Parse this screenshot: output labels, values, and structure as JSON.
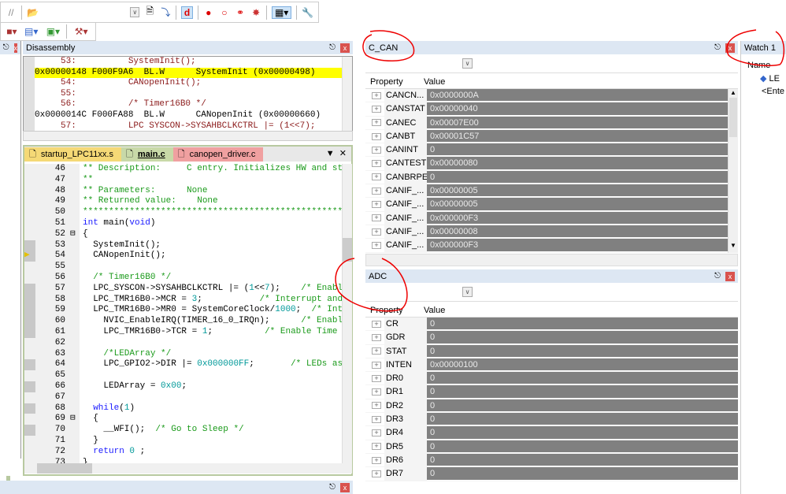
{
  "toolbar": {
    "row1_icons": [
      "comment-icon",
      "open-folder-icon",
      "dropdown-icon",
      "find-icon",
      "download-icon",
      "debug-session-icon",
      "breakpoint-insert-icon",
      "breakpoint-enable-icon",
      "breakpoint-disable-all-icon",
      "breakpoint-kill-all-icon",
      "window-layout-icon",
      "wrench-icon"
    ],
    "row2_icons": [
      "build-icon",
      "batch-icon",
      "chip-icon",
      "tools-icon"
    ]
  },
  "disassembly": {
    "title": "Disassembly",
    "lines": [
      {
        "text": "     53:          SystemInit();",
        "type": "src"
      },
      {
        "text": "0x00000148 F000F9A6  BL.W      SystemInit (0x00000498)",
        "type": "current"
      },
      {
        "text": "     54:          CANopenInit();",
        "type": "src"
      },
      {
        "text": "     55:",
        "type": "src"
      },
      {
        "text": "     56:          /* Timer16B0 */",
        "type": "src"
      },
      {
        "text": "0x0000014C F000FA88  BL.W      CANopenInit (0x00000660)",
        "type": "breakpoint"
      },
      {
        "text": "     57:          LPC SYSCON->SYSAHBCLKCTRL |= (1<<7);",
        "type": "src"
      }
    ]
  },
  "editor": {
    "tabs": [
      {
        "label": "startup_LPC11xx.s",
        "color": "#f5d976"
      },
      {
        "label": "main.c",
        "color": "#c8d9a8"
      },
      {
        "label": "canopen_driver.c",
        "color": "#f0a0a0"
      }
    ],
    "lines": [
      {
        "n": "46",
        "html": "<span class='cm'>** Description:     C entry. Initializes HW and st</span>"
      },
      {
        "n": "47",
        "html": "<span class='cm'>**</span>"
      },
      {
        "n": "48",
        "html": "<span class='cm'>** Parameters:      None</span>"
      },
      {
        "n": "49",
        "html": "<span class='cm'>** Returned value:    None</span>"
      },
      {
        "n": "50",
        "html": "<span class='cm'>**************************************************</span>"
      },
      {
        "n": "51",
        "html": "<span class='kw'>int</span> main(<span class='kw'>void</span>)"
      },
      {
        "n": "52",
        "html": "{"
      },
      {
        "n": "53",
        "html": "  SystemInit();"
      },
      {
        "n": "54",
        "html": "  CANopenInit();"
      },
      {
        "n": "55",
        "html": ""
      },
      {
        "n": "56",
        "html": "  <span class='cm'>/* Timer16B0 */</span>"
      },
      {
        "n": "57",
        "html": "  LPC_SYSCON->SYSAHBCLKCTRL |= (<span class='nm'>1</span>&lt;&lt;<span class='nm'>7</span>);    <span class='cm'>/* Enabl</span>"
      },
      {
        "n": "58",
        "html": "  LPC_TMR16B0->MCR = <span class='nm'>3</span>;           <span class='cm'>/* Interrupt and</span>"
      },
      {
        "n": "59",
        "html": "  LPC_TMR16B0->MR0 = SystemCoreClock/<span class='nm'>1000</span>;  <span class='cm'>/* Int</span>"
      },
      {
        "n": "60",
        "html": "    NVIC_EnableIRQ(TIMER_16_0_IRQn);      <span class='cm'>/* Enabl</span>"
      },
      {
        "n": "61",
        "html": "    LPC_TMR16B0->TCR = <span class='nm'>1</span>;          <span class='cm'>/* Enable Time</span>"
      },
      {
        "n": "62",
        "html": ""
      },
      {
        "n": "63",
        "html": "    <span class='cm'>/*LEDArray */</span>"
      },
      {
        "n": "64",
        "html": "    LPC_GPIO2->DIR |= <span class='nm'>0x000000FF</span>;       <span class='cm'>/* LEDs as</span>"
      },
      {
        "n": "65",
        "html": ""
      },
      {
        "n": "66",
        "html": "    LEDArray = <span class='nm'>0x00</span>;"
      },
      {
        "n": "67",
        "html": ""
      },
      {
        "n": "68",
        "html": "  <span class='kw'>while</span>(<span class='nm'>1</span>)"
      },
      {
        "n": "69",
        "html": "  {"
      },
      {
        "n": "70",
        "html": "    __WFI();  <span class='cm'>/* Go to Sleep */</span>"
      },
      {
        "n": "71",
        "html": "  }"
      },
      {
        "n": "72",
        "html": "  <span class='kw'>return</span> <span class='nm'>0</span> ;"
      },
      {
        "n": "73",
        "html": "}"
      }
    ]
  },
  "ccan": {
    "title": "C_CAN",
    "col_property": "Property",
    "col_value": "Value",
    "rows": [
      {
        "name": "CANCN...",
        "value": "0x0000000A"
      },
      {
        "name": "CANSTAT",
        "value": "0x00000040"
      },
      {
        "name": "CANEC",
        "value": "0x00007E00"
      },
      {
        "name": "CANBT",
        "value": "0x00001C57"
      },
      {
        "name": "CANINT",
        "value": "0"
      },
      {
        "name": "CANTEST",
        "value": "0x00000080"
      },
      {
        "name": "CANBRPE",
        "value": "0"
      },
      {
        "name": "CANIF_...",
        "value": "0x00000005"
      },
      {
        "name": "CANIF_...",
        "value": "0x00000005"
      },
      {
        "name": "CANIF_...",
        "value": "0x000000F3"
      },
      {
        "name": "CANIF_...",
        "value": "0x00000008"
      },
      {
        "name": "CANIF_...",
        "value": "0x000000F3"
      }
    ]
  },
  "adc": {
    "title": "ADC",
    "col_property": "Property",
    "col_value": "Value",
    "rows": [
      {
        "name": "CR",
        "value": "0"
      },
      {
        "name": "GDR",
        "value": "0"
      },
      {
        "name": "STAT",
        "value": "0"
      },
      {
        "name": "INTEN",
        "value": "0x00000100"
      },
      {
        "name": "DR0",
        "value": "0"
      },
      {
        "name": "DR1",
        "value": "0"
      },
      {
        "name": "DR2",
        "value": "0"
      },
      {
        "name": "DR3",
        "value": "0"
      },
      {
        "name": "DR4",
        "value": "0"
      },
      {
        "name": "DR5",
        "value": "0"
      },
      {
        "name": "DR6",
        "value": "0"
      },
      {
        "name": "DR7",
        "value": "0"
      }
    ]
  },
  "watch": {
    "title": "Watch 1",
    "col_name": "Name",
    "item": "LE",
    "enter": "<Ente"
  },
  "colors": {
    "current_line": "#ffff00",
    "annotation": "#e00000",
    "value_bg": "#808080"
  }
}
